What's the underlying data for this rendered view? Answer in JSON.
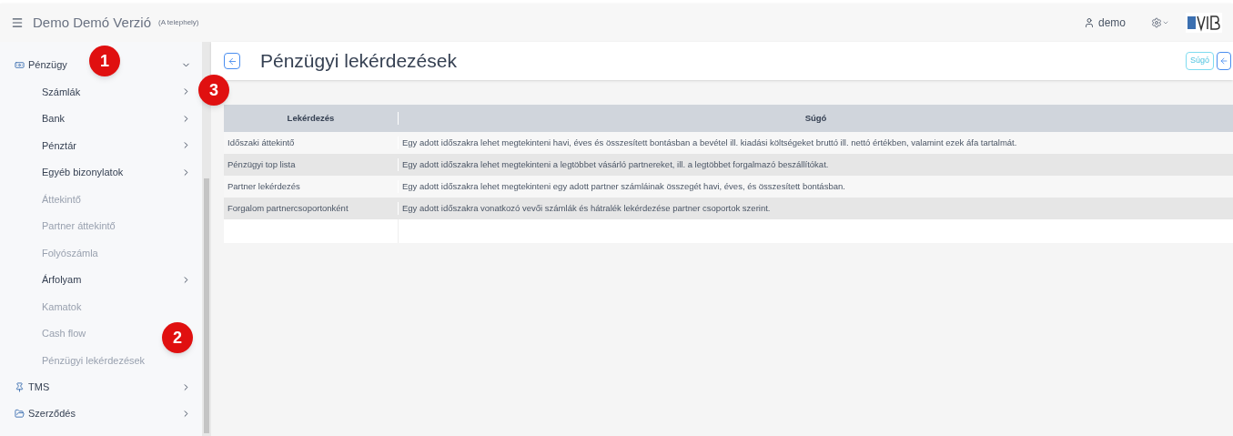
{
  "topbar": {
    "title": "Demo Demó Verzió",
    "subtitle": "(A telephely)",
    "user": "demo"
  },
  "sidebar": {
    "items": [
      {
        "label": "Pénzügy",
        "expanded": true,
        "children": [
          {
            "label": "Számlák",
            "has_submenu": true
          },
          {
            "label": "Bank",
            "has_submenu": true
          },
          {
            "label": "Pénztár",
            "has_submenu": true
          },
          {
            "label": "Egyéb bizonylatok",
            "has_submenu": true
          },
          {
            "label": "Áttekintő",
            "has_submenu": false
          },
          {
            "label": "Partner áttekintő",
            "has_submenu": false
          },
          {
            "label": "Folyószámla",
            "has_submenu": false
          },
          {
            "label": "Árfolyam",
            "has_submenu": true
          },
          {
            "label": "Kamatok",
            "has_submenu": false
          },
          {
            "label": "Cash flow",
            "has_submenu": false
          },
          {
            "label": "Pénzügyi lekérdezések",
            "has_submenu": false
          }
        ]
      },
      {
        "label": "TMS",
        "expanded": false
      },
      {
        "label": "Szerződés",
        "expanded": false
      }
    ]
  },
  "page": {
    "title": "Pénzügyi lekérdezések",
    "help_button": "Súgó"
  },
  "table": {
    "columns": [
      "Lekérdezés",
      "Súgó"
    ],
    "rows": [
      [
        "Időszaki áttekintő",
        "Egy adott időszakra lehet megtekinteni havi, éves és összesített bontásban a bevétel ill. kiadási költségeket bruttó ill. nettó értékben, valamint ezek áfa tartalmát."
      ],
      [
        "Pénzügyi top lista",
        "Egy adott időszakra lehet megtekinteni a legtöbbet vásárló partnereket, ill. a legtöbbet forgalmazó beszállítókat."
      ],
      [
        "Partner lekérdezés",
        "Egy adott időszakra lehet megtekinteni egy adott partner számláinak összegét havi, éves, és összesített bontásban."
      ],
      [
        "Forgalom partnercsoportonként",
        "Egy adott időszakra vonatkozó vevői számlák és hátralék lekérdezése partner csoportok szerint."
      ]
    ]
  },
  "callouts": [
    {
      "label": "1"
    },
    {
      "label": "2"
    },
    {
      "label": "3"
    }
  ]
}
